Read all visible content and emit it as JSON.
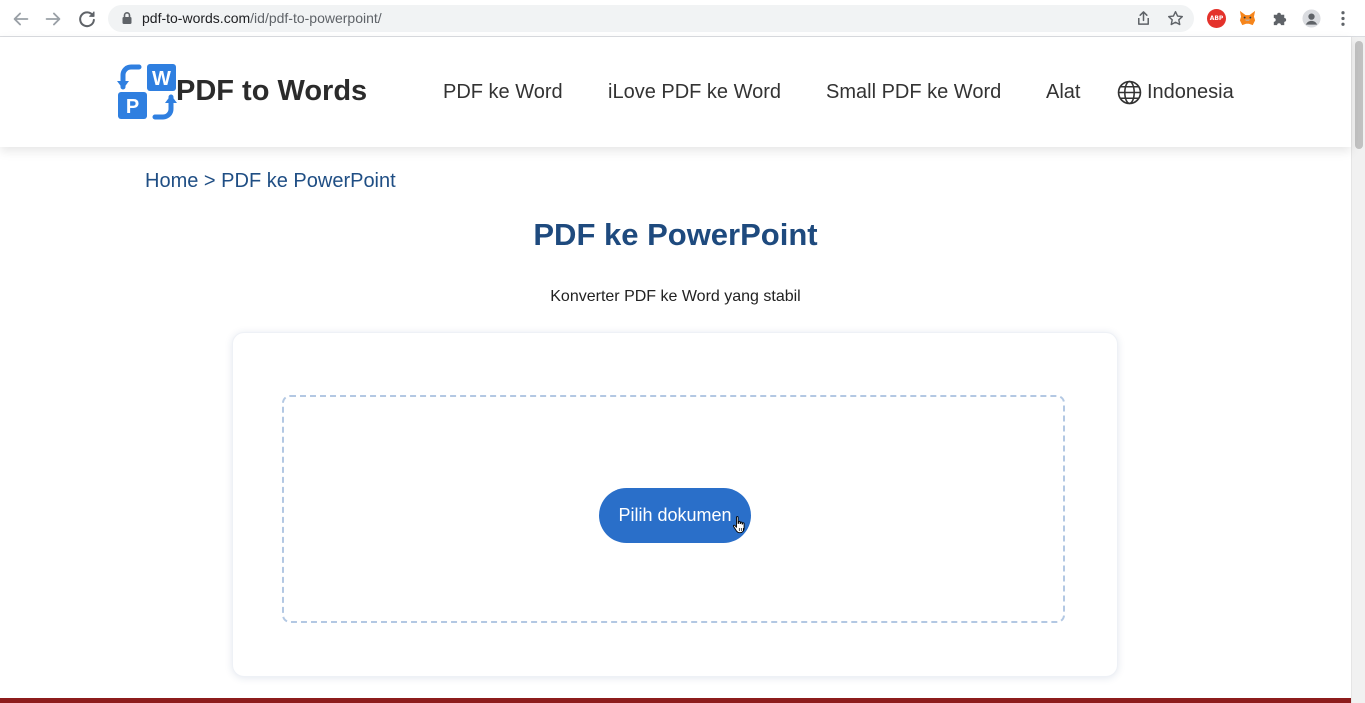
{
  "browser": {
    "url_domain": "pdf-to-words.com",
    "url_path": "/id/pdf-to-powerpoint/"
  },
  "header": {
    "logo_text": "PDF to Words",
    "logo_letters": {
      "top": "W",
      "bottom": "P"
    },
    "nav": [
      {
        "label": "PDF ke Word"
      },
      {
        "label": "iLove PDF ke Word"
      },
      {
        "label": "Small PDF ke Word"
      },
      {
        "label": "Alat"
      }
    ],
    "language": "Indonesia"
  },
  "breadcrumb": {
    "home": "Home",
    "separator": ">",
    "current": "PDF ke PowerPoint"
  },
  "main": {
    "title": "PDF ke PowerPoint",
    "subtitle": "Konverter PDF ke Word yang stabil",
    "upload_button": "Pilih dokumen"
  },
  "extensions": {
    "abp_label": "ABP"
  },
  "colors": {
    "accent_blue": "#2a6fc9",
    "title_blue": "#1e4a7e",
    "link_blue": "#1f4e84",
    "dropzone_border": "#b3c8e3",
    "footer_red": "#8d1c1c"
  }
}
